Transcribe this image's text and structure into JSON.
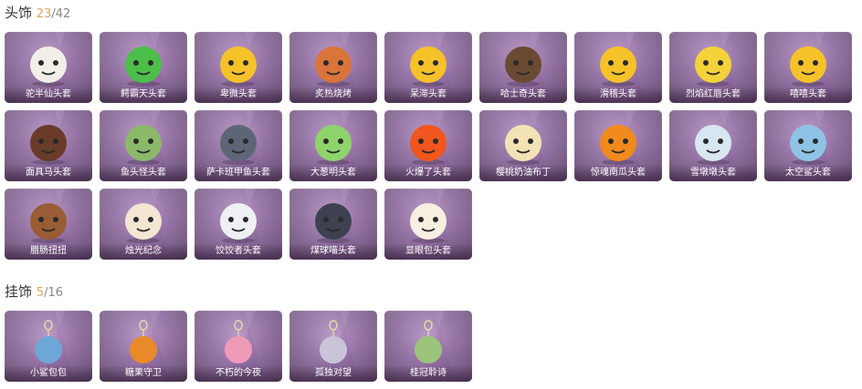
{
  "sections": [
    {
      "title": "头饰",
      "owned": "23",
      "total": "/42",
      "items": [
        {
          "name": "驼半仙头套",
          "icon": "alpaca-head-icon",
          "color": "#f2efe9"
        },
        {
          "name": "鳄霸天头套",
          "icon": "crocodile-head-icon",
          "color": "#4bbf4a"
        },
        {
          "name": "卑微头套",
          "icon": "sad-emoji-head-icon",
          "color": "#f6c22a"
        },
        {
          "name": "炙热烧烤",
          "icon": "grill-head-icon",
          "color": "#d9743a"
        },
        {
          "name": "呆滞头套",
          "icon": "dazed-emoji-head-icon",
          "color": "#f6c22a"
        },
        {
          "name": "哈士奇头套",
          "icon": "husky-head-icon",
          "color": "#6b4a33"
        },
        {
          "name": "滑稽头套",
          "icon": "funny-emoji-head-icon",
          "color": "#f6c22a"
        },
        {
          "name": "烈焰红唇头套",
          "icon": "pikachu-head-icon",
          "color": "#f4d23a"
        },
        {
          "name": "嘻嘻头套",
          "icon": "grin-emoji-head-icon",
          "color": "#f6c22a"
        },
        {
          "name": "面具马头套",
          "icon": "horse-head-icon",
          "color": "#6a3b2a"
        },
        {
          "name": "鱼头怪头套",
          "icon": "fish-monster-head-icon",
          "color": "#8cb86a"
        },
        {
          "name": "萨卡班甲鱼头套",
          "icon": "sacabambaspis-head-icon",
          "color": "#5d6677"
        },
        {
          "name": "大葱明头套",
          "icon": "scallion-head-icon",
          "color": "#8fd36b"
        },
        {
          "name": "火爆了头套",
          "icon": "fireball-head-icon",
          "color": "#f0561d"
        },
        {
          "name": "樱桃奶油布丁",
          "icon": "pudding-head-icon",
          "color": "#f3e2b6"
        },
        {
          "name": "惊魂南瓜头套",
          "icon": "pumpkin-head-icon",
          "color": "#f08a1c"
        },
        {
          "name": "雪墩墩头套",
          "icon": "snow-reindeer-head-icon",
          "color": "#d8e6f2"
        },
        {
          "name": "太空鲨头套",
          "icon": "space-shark-head-icon",
          "color": "#8ec3e6"
        },
        {
          "name": "腊肠扭扭",
          "icon": "dachshund-head-icon",
          "color": "#9a5c34"
        },
        {
          "name": "烛光纪念",
          "icon": "candle-head-icon",
          "color": "#f3e6d2"
        },
        {
          "name": "饺饺者头套",
          "icon": "dumpling-head-icon",
          "color": "#eef1f4"
        },
        {
          "name": "煤球喵头套",
          "icon": "black-cat-head-icon",
          "color": "#3d4150"
        },
        {
          "name": "显眼包头套",
          "icon": "bun-head-icon",
          "color": "#f7efe0"
        }
      ]
    },
    {
      "title": "挂饰",
      "owned": "5",
      "total": "/16",
      "items": [
        {
          "name": "小鲨包包",
          "icon": "shark-bag-charm-icon",
          "color": "#6fa6d8"
        },
        {
          "name": "糖果守卫",
          "icon": "candy-guard-charm-icon",
          "color": "#e88a2a"
        },
        {
          "name": "不朽的今夜",
          "icon": "pink-cat-charm-icon",
          "color": "#ef9bb8"
        },
        {
          "name": "孤独对望",
          "icon": "figure-charm-icon",
          "color": "#c9c4d8"
        },
        {
          "name": "桂冠聆诗",
          "icon": "laurel-figure-charm-icon",
          "color": "#9bc47a"
        }
      ]
    }
  ]
}
